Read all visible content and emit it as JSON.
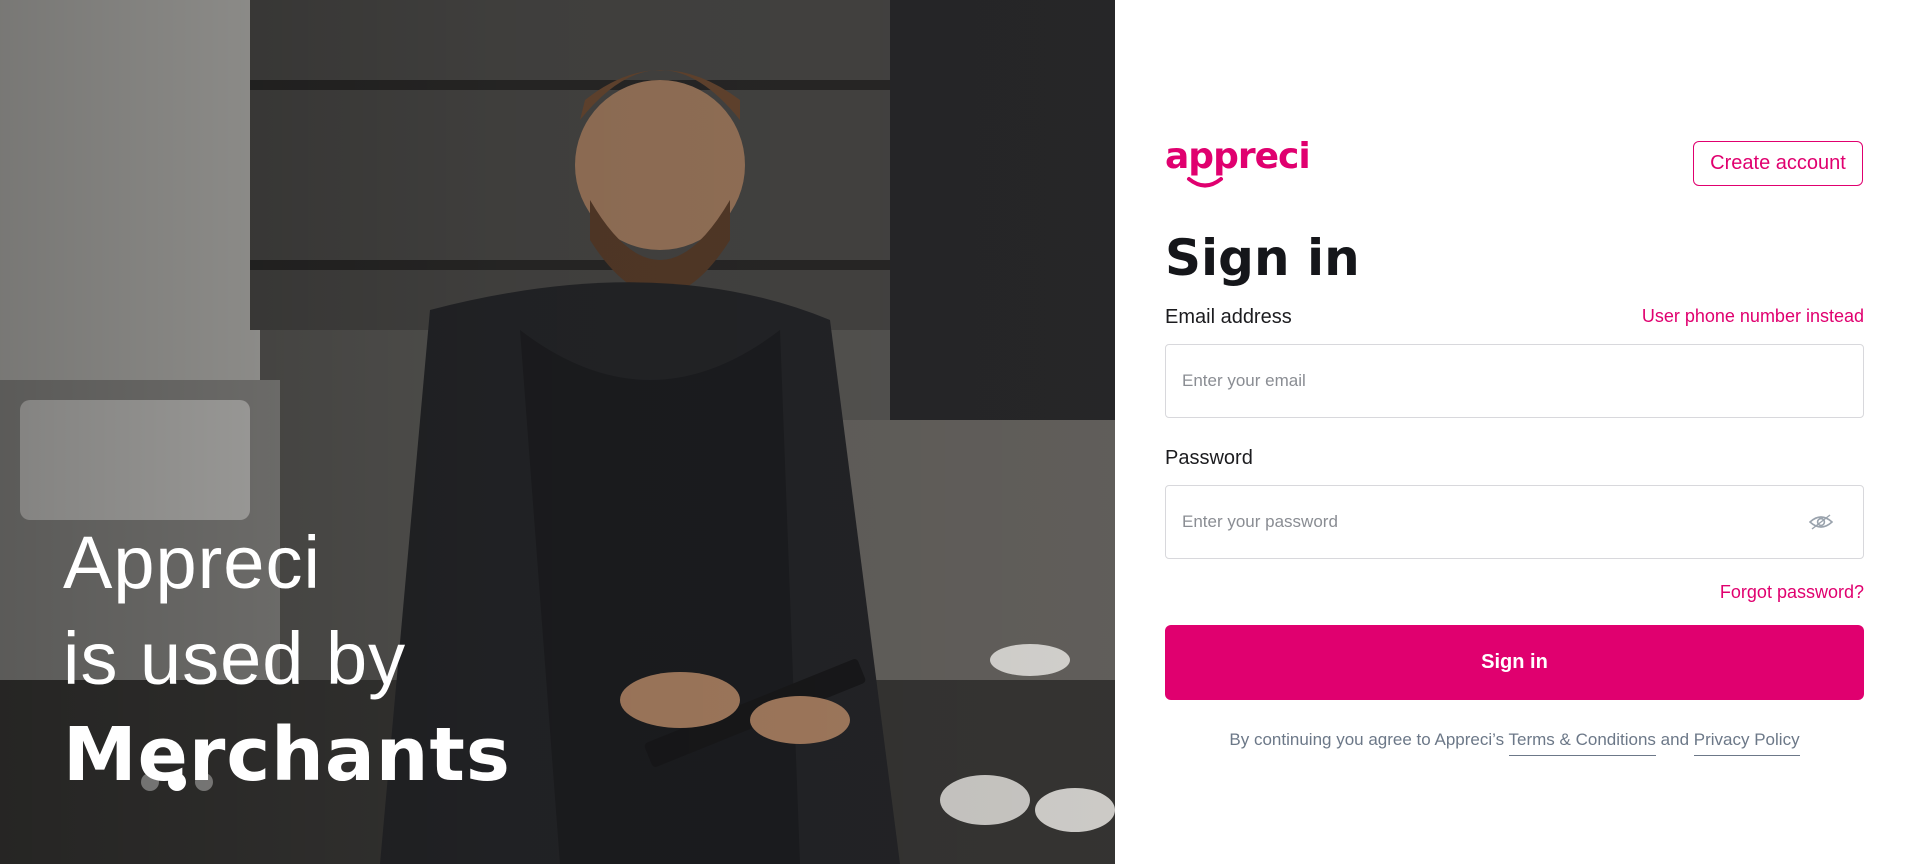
{
  "hero": {
    "line1": "Appreci",
    "line2": "is used by",
    "line3": "Merchants",
    "carousel_dots": 3,
    "active_dot": 2
  },
  "brand": {
    "logo_text": "appreci",
    "accent_color": "#e0006f"
  },
  "header": {
    "create_account_label": "Create account"
  },
  "form": {
    "title": "Sign in",
    "email_label": "Email address",
    "phone_switch_label": "User phone number instead",
    "email_placeholder": "Enter your email",
    "password_label": "Password",
    "password_placeholder": "Enter your password",
    "password_toggle_icon": "eye-icon",
    "forgot_password_label": "Forgot password?",
    "submit_label": "Sign in"
  },
  "legal": {
    "prefix": "By continuing you agree to Appreci’s",
    "terms_label": "Terms & Conditions",
    "and_text": "and",
    "privacy_label": "Privacy Policy"
  }
}
